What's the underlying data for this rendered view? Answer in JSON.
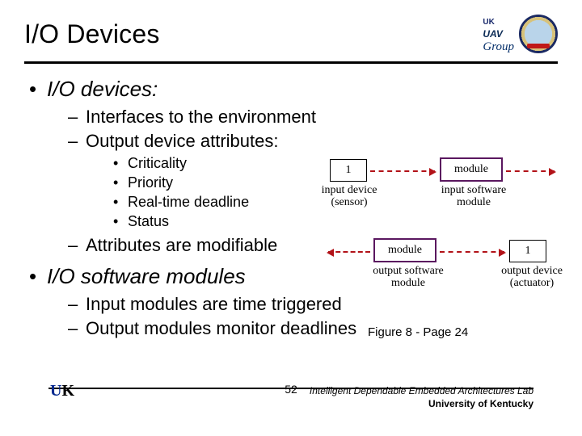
{
  "header": {
    "title": "I/O Devices",
    "uk": "UK",
    "uav": "UAV",
    "group": "Group"
  },
  "content": {
    "h1": "I/O devices:",
    "l2a": "Interfaces to the environment",
    "l2b": "Output device attributes:",
    "attrs": [
      "Criticality",
      "Priority",
      "Real-time deadline",
      "Status"
    ],
    "l2c": "Attributes are modifiable",
    "h2": "I/O software modules",
    "l2d": "Input modules are time triggered",
    "l2e": "Output modules monitor deadlines"
  },
  "figure": {
    "one_top": "1",
    "module_top": "module",
    "in_dev": "input device\n(sensor)",
    "in_mod": "input software\nmodule",
    "module_bot": "module",
    "one_bot": "1",
    "out_mod": "output software\nmodule",
    "out_dev": "output device\n(actuator)",
    "caption": "Figure 8 - Page 24"
  },
  "footer": {
    "page": "52",
    "lab": "Intelligent Dependable Embedded Architectures Lab",
    "univ": "University of Kentucky",
    "uk_u": "U",
    "uk_k": "K"
  }
}
